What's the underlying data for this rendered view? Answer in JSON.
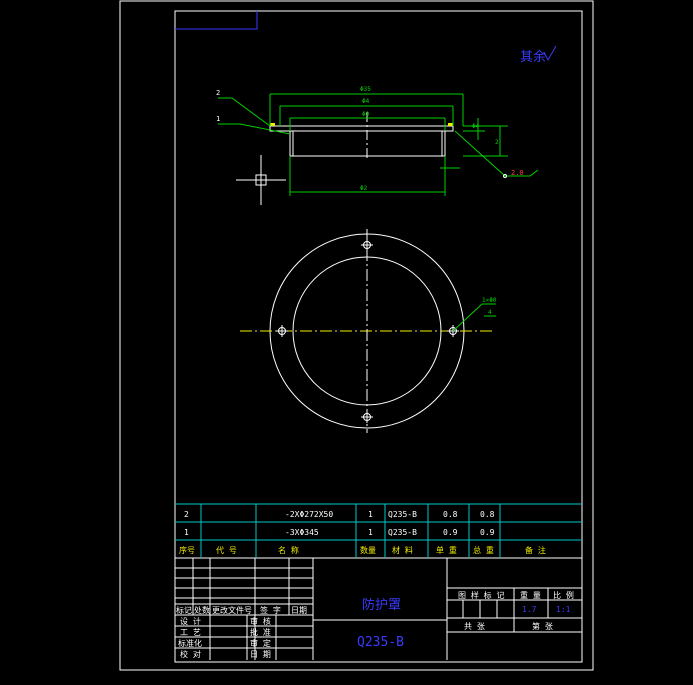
{
  "roughness_note": "其余",
  "front_view": {
    "dims": [
      "Φ35",
      "Φ4",
      "Φ0",
      "Φ2",
      "2.0",
      "2",
      "Φ4"
    ],
    "callouts": [
      "2",
      "1"
    ],
    "chamfer": "2.0"
  },
  "plan_view": {
    "hole_note": "1×Φ0",
    "hole_note_sub": "4"
  },
  "parts_table": {
    "rows": [
      {
        "seq": "2",
        "code": "",
        "name": "-2XΦ272X50",
        "qty": "1",
        "material": "Q235-B",
        "unit_wt": "0.8",
        "total_wt": "0.8",
        "note": ""
      },
      {
        "seq": "1",
        "code": "",
        "name": "-3XΦ345",
        "qty": "1",
        "material": "Q235-B",
        "unit_wt": "0.9",
        "total_wt": "0.9",
        "note": ""
      }
    ],
    "header": {
      "seq": "序号",
      "code": "代  号",
      "name": "名  称",
      "qty": "数量",
      "material": "材  料",
      "unit_wt": "单 重",
      "total_wt": "总 重",
      "note": "备  注"
    }
  },
  "title_block": {
    "part_name": "防护罩",
    "material": "Q235-B",
    "revision_labels": [
      "标记",
      "处数",
      "更改文件号",
      "签 字",
      "日期"
    ],
    "sign_rows": [
      [
        "设 计",
        "",
        "审 核",
        ""
      ],
      [
        "工 艺",
        "",
        "批 准",
        ""
      ],
      [
        "标准化",
        "",
        "审 定",
        ""
      ],
      [
        "校 对",
        "",
        "日 期",
        ""
      ]
    ],
    "stage_labels": [
      "图 样 标 记",
      "重 量",
      "比 例"
    ],
    "weight": "1.7",
    "scale": "1:1",
    "sheets_total_label": "共    张",
    "sheet_no_label": "第    张"
  }
}
